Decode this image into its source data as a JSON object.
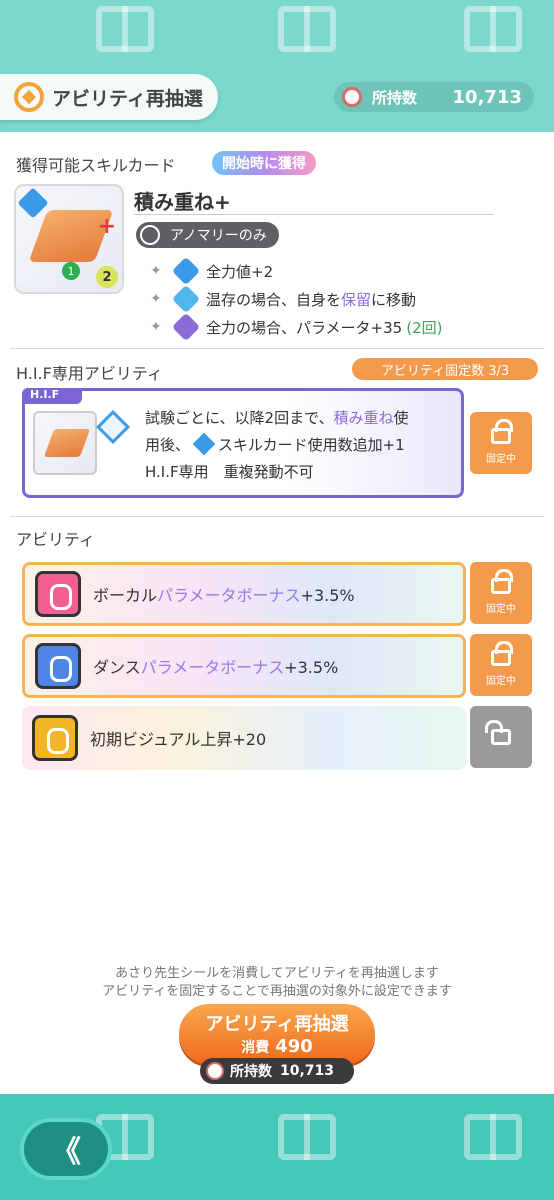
{
  "header": {
    "title": "アビリティ再抽選",
    "owned_label": "所持数",
    "owned_value": "10,713"
  },
  "skill_card": {
    "section_title": "獲得可能スキルカード",
    "start_badge": "開始時に獲得",
    "name": "積み重ね+",
    "tag": "アノマリーのみ",
    "cost_a": "1",
    "cost_b": "2",
    "effects": [
      {
        "text": "全力値+2"
      },
      {
        "text_a": "温存の場合、自身を",
        "highlight": "保留",
        "text_b": "に移動"
      },
      {
        "text": "全力の場合、パラメータ+35",
        "extra": "(2回)"
      }
    ]
  },
  "hif": {
    "section_title": "H.I.F専用アビリティ",
    "fixed_count_label": "アビリティ固定数 3/3",
    "tag": "H.I.F",
    "line1_a": "試験ごとに、以降2回まで、",
    "line1_highlight": "積み重ね",
    "line1_b": "使",
    "line2_a": "用後、",
    "line2_b": "スキルカード使用数追加+1",
    "line3": "H.I.F専用　重複発動不可",
    "lock_label": "固定中"
  },
  "abilities": {
    "section_title": "アビリティ",
    "items": [
      {
        "prefix": "ボーカル",
        "highlight": "パラメータボーナス",
        "suffix": "+3.5%",
        "lock_label": "固定中",
        "locked": true
      },
      {
        "prefix": "ダンス",
        "highlight": "パラメータボーナス",
        "suffix": "+3.5%",
        "lock_label": "固定中",
        "locked": true
      },
      {
        "prefix": "初期ビジュアル上昇+20",
        "highlight": "",
        "suffix": "",
        "lock_label": "",
        "locked": false
      }
    ]
  },
  "footer": {
    "info_line1": "あさり先生シールを消費してアビリティを再抽選します",
    "info_line2": "アビリティを固定することで再抽選の対象外に設定できます",
    "reroll_label": "アビリティ再抽選",
    "cost_label": "消費",
    "cost_value": "490",
    "owned_label": "所持数",
    "owned_value": "10,713",
    "back_glyph": "《"
  },
  "colors": {
    "teal": "#7ad8cc",
    "orange": "#f49a4c",
    "purple": "#7a64d6"
  }
}
